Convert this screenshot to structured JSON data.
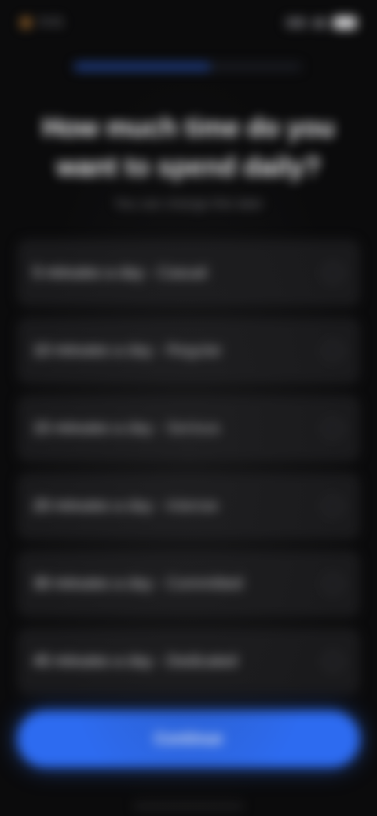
{
  "status_bar": {
    "time": "9:41",
    "icons": [
      "signal-icon",
      "wifi-icon",
      "battery-icon"
    ]
  },
  "progress": {
    "fraction": 0.6
  },
  "header": {
    "title": "How much time do you want to spend daily?",
    "subtitle": "You can change this later"
  },
  "options": [
    {
      "label": "5 minutes a day - Casual"
    },
    {
      "label": "10 minutes a day - Regular"
    },
    {
      "label": "15 minutes a day - Serious"
    },
    {
      "label": "20 minutes a day - Intense"
    },
    {
      "label": "30 minutes a day - Committed"
    },
    {
      "label": "45 minutes a day - Dedicated"
    }
  ],
  "footer": {
    "continue_label": "Continue"
  },
  "colors": {
    "accent": "#2d6bf0",
    "background": "#0b0b0c",
    "card": "#1a1a1c"
  }
}
